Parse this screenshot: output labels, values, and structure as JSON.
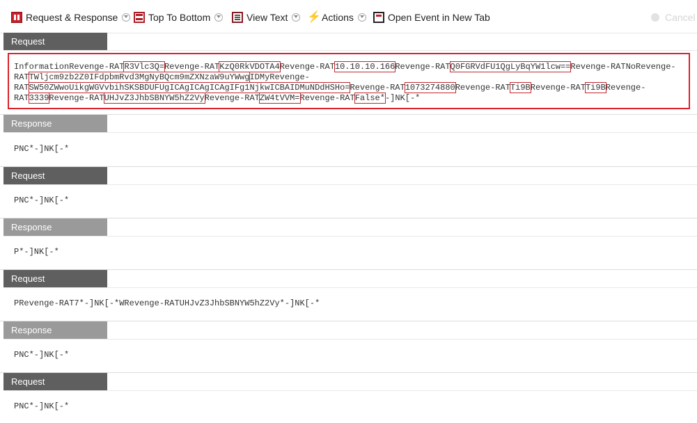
{
  "toolbar": {
    "request_response": "Request & Response",
    "top_to_bottom": "Top To Bottom",
    "view_text": "View Text",
    "actions": "Actions",
    "open_event": "Open Event in New Tab",
    "cancel": "Cancel"
  },
  "sections": [
    {
      "type": "Request"
    },
    {
      "type": "Response",
      "body": "PNC*-]NK[-*"
    },
    {
      "type": "Request",
      "body": "PNC*-]NK[-*"
    },
    {
      "type": "Response",
      "body": "P*-]NK[-*"
    },
    {
      "type": "Request",
      "body": "PRevenge-RAT7*-]NK[-*WRevenge-RATUHJvZ3JhbSBNYW5hZ2Vy*-]NK[-*"
    },
    {
      "type": "Response",
      "body": "PNC*-]NK[-*"
    },
    {
      "type": "Request",
      "body": "PNC*-]NK[-*"
    }
  ],
  "first_request": {
    "line1": [
      {
        "t": "InformationRevenge-RAT",
        "h": false
      },
      {
        "t": "R3Vlc3Q=",
        "h": true
      },
      {
        "t": "Revenge-RAT",
        "h": false
      },
      {
        "t": "KzQ0RkVDOTA4",
        "h": true
      },
      {
        "t": "Revenge-RAT",
        "h": false
      },
      {
        "t": "10.10.10.166",
        "h": true
      },
      {
        "t": "Revenge-RAT",
        "h": false
      },
      {
        "t": "Q0FGRVdFU1QgLyBqYW1lcw==",
        "h": true
      },
      {
        "t": "Revenge-RATNoRevenge-",
        "h": false
      }
    ],
    "line2": [
      {
        "t": "RAT",
        "h": false
      },
      {
        "t": "TWljcm9zb2Z0IFdpbmRvd3MgNyBQcm9mZXNzaW9uYWwg",
        "h": true
      },
      {
        "t": "IDMyRevenge-",
        "h": false
      }
    ],
    "line3": [
      {
        "t": "RAT",
        "h": false
      },
      {
        "t": "SW50ZWwoUikgWGVvbihSKSBDUFUgICAgICAgICAgIFg1NjkwICBAIDMuNDdHSHo=",
        "h": true
      },
      {
        "t": "Revenge-RAT",
        "h": false
      },
      {
        "t": "1073274880",
        "h": true
      },
      {
        "t": "Revenge-RAT",
        "h": false
      },
      {
        "t": "Ti9B",
        "h": true
      },
      {
        "t": "Revenge-RAT",
        "h": false
      },
      {
        "t": "Ti9B",
        "h": true
      },
      {
        "t": "Revenge-",
        "h": false
      }
    ],
    "line4": [
      {
        "t": "RAT",
        "h": false
      },
      {
        "t": "3339",
        "h": true
      },
      {
        "t": "Revenge-RAT",
        "h": false
      },
      {
        "t": "UHJvZ3JhbSBNYW5hZ2Vy",
        "h": true
      },
      {
        "t": "Revenge-RAT",
        "h": false
      },
      {
        "t": "ZW4tVVM=",
        "h": true
      },
      {
        "t": "Revenge-RAT",
        "h": false
      },
      {
        "t": "False*",
        "h": true
      },
      {
        "t": "-]NK[-*",
        "h": false
      }
    ]
  }
}
